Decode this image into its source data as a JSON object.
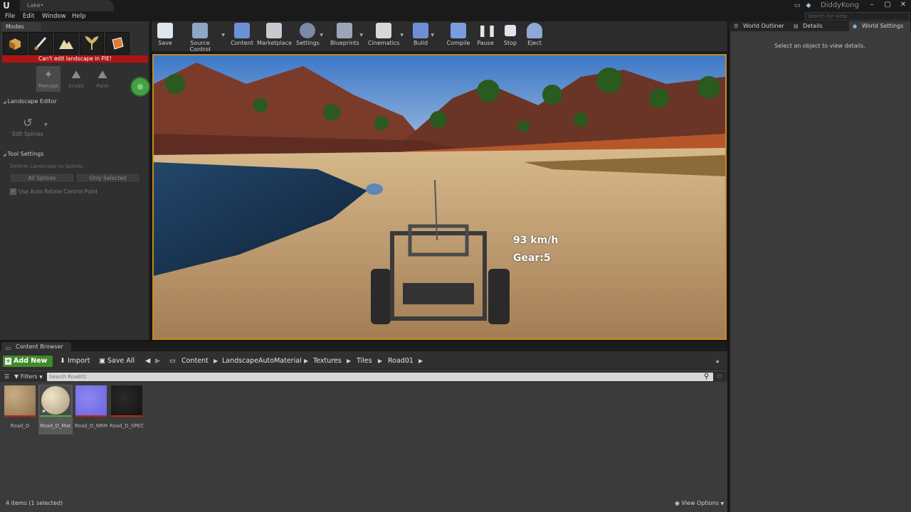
{
  "window": {
    "tab_title": "Lake•",
    "user": "DiddyKong",
    "search_help_placeholder": "Search For Help"
  },
  "menu": [
    "File",
    "Edit",
    "Window",
    "Help"
  ],
  "modes": {
    "tab_label": "Modes",
    "warning": "Can't edit landscape in PIE!",
    "tools": [
      "Manage",
      "Sculpt",
      "Paint"
    ],
    "landscape_editor_label": "Landscape Editor",
    "edit_splines_label": "Edit Splines",
    "tool_settings_label": "Tool Settings",
    "deform_label": "Deform Landscape to Splines",
    "all_splines": "All Splines",
    "only_selected": "Only Selected",
    "auto_rotate_label": "Use Auto Rotate Control Point",
    "auto_rotate_checked": true
  },
  "toolbar": [
    "Save",
    "Source Control",
    "Content",
    "Marketplace",
    "Settings",
    "Blueprints",
    "Cinematics",
    "Build",
    "Compile",
    "Pause",
    "Stop",
    "Eject"
  ],
  "hud": {
    "speed": "93 km/h",
    "gear": "Gear:5"
  },
  "right_panel": {
    "tabs": [
      "World Outliner",
      "Details",
      "World Settings"
    ],
    "empty_message": "Select an object to view details."
  },
  "content_browser": {
    "tab_label": "Content Browser",
    "add_new": "Add New",
    "import": "Import",
    "save_all": "Save All",
    "breadcrumb": [
      "Content",
      "LandscapeAutoMaterial",
      "Textures",
      "Tiles",
      "Road01"
    ],
    "filters": "Filters",
    "search_placeholder": "Search Road01",
    "assets": [
      "Road_D",
      "Road_D_Mat",
      "Road_D_NRM",
      "Road_D_SPEC"
    ],
    "status": "4 items (1 selected)",
    "view_options": "View Options"
  },
  "colors": {
    "viewport_border": "#c68a22",
    "warning_bg": "#b01313",
    "add_new_bg": "#3f8a2a"
  }
}
